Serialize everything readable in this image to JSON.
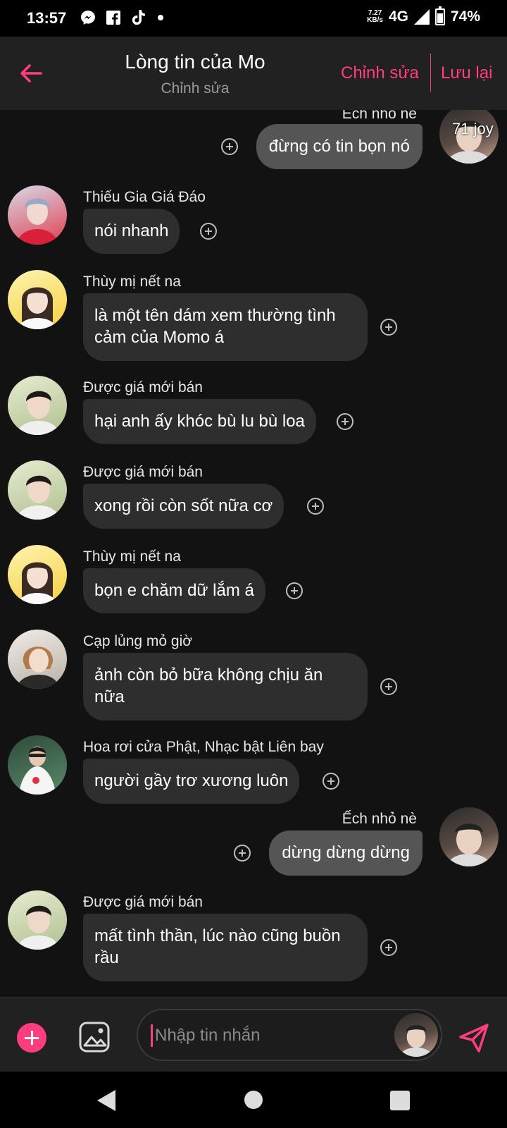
{
  "status_bar": {
    "time": "13:57",
    "speed_value": "7.27",
    "speed_unit": "KB/s",
    "network": "4G",
    "battery": "74%",
    "app_icons": [
      "messenger-icon",
      "facebook-icon",
      "tiktok-icon"
    ]
  },
  "header": {
    "title": "Lòng tin của Mo",
    "subtitle": "Chỉnh sửa",
    "edit_label": "Chỉnh sửa",
    "save_label": "Lưu lại"
  },
  "messages": [
    {
      "sender": "Ếch nhỏ nè",
      "text": "đừng có tin bọn nó",
      "direction": "out",
      "avatar_text": "71 joy"
    },
    {
      "sender": "Thiếu Gia Giá Đáo",
      "text": "nói nhanh",
      "direction": "in"
    },
    {
      "sender": "Thùy mị nết na",
      "text": "là một tên dám xem thường tình cảm của Momo á",
      "direction": "in"
    },
    {
      "sender": "Được giá mới bán",
      "text": "hại anh ấy khóc bù lu bù loa",
      "direction": "in"
    },
    {
      "sender": "Được giá mới bán",
      "text": "xong rồi còn sốt nữa cơ",
      "direction": "in"
    },
    {
      "sender": "Thùy mị nết na",
      "text": "bọn e chăm dữ lắm á",
      "direction": "in"
    },
    {
      "sender": "Cạp lủng mỏ giờ",
      "text": "ảnh còn bỏ bữa không chịu ăn nữa",
      "direction": "in"
    },
    {
      "sender": "Hoa rơi cửa Phật, Nhạc bật Liên bay",
      "text": "người gầy trơ xương luôn",
      "direction": "in"
    },
    {
      "sender": "Ếch nhỏ nè",
      "text": "dừng dừng dừng",
      "direction": "out"
    },
    {
      "sender": "Được giá mới bán",
      "text": "mất tình thần, lúc nào cũng buồn rầu",
      "direction": "in"
    }
  ],
  "input": {
    "placeholder": "Nhập tin nhắn"
  },
  "colors": {
    "accent": "#ff3d7f",
    "background": "#121212",
    "header": "#212121",
    "bubble_in": "#2e2e2e",
    "bubble_out": "#555555"
  }
}
